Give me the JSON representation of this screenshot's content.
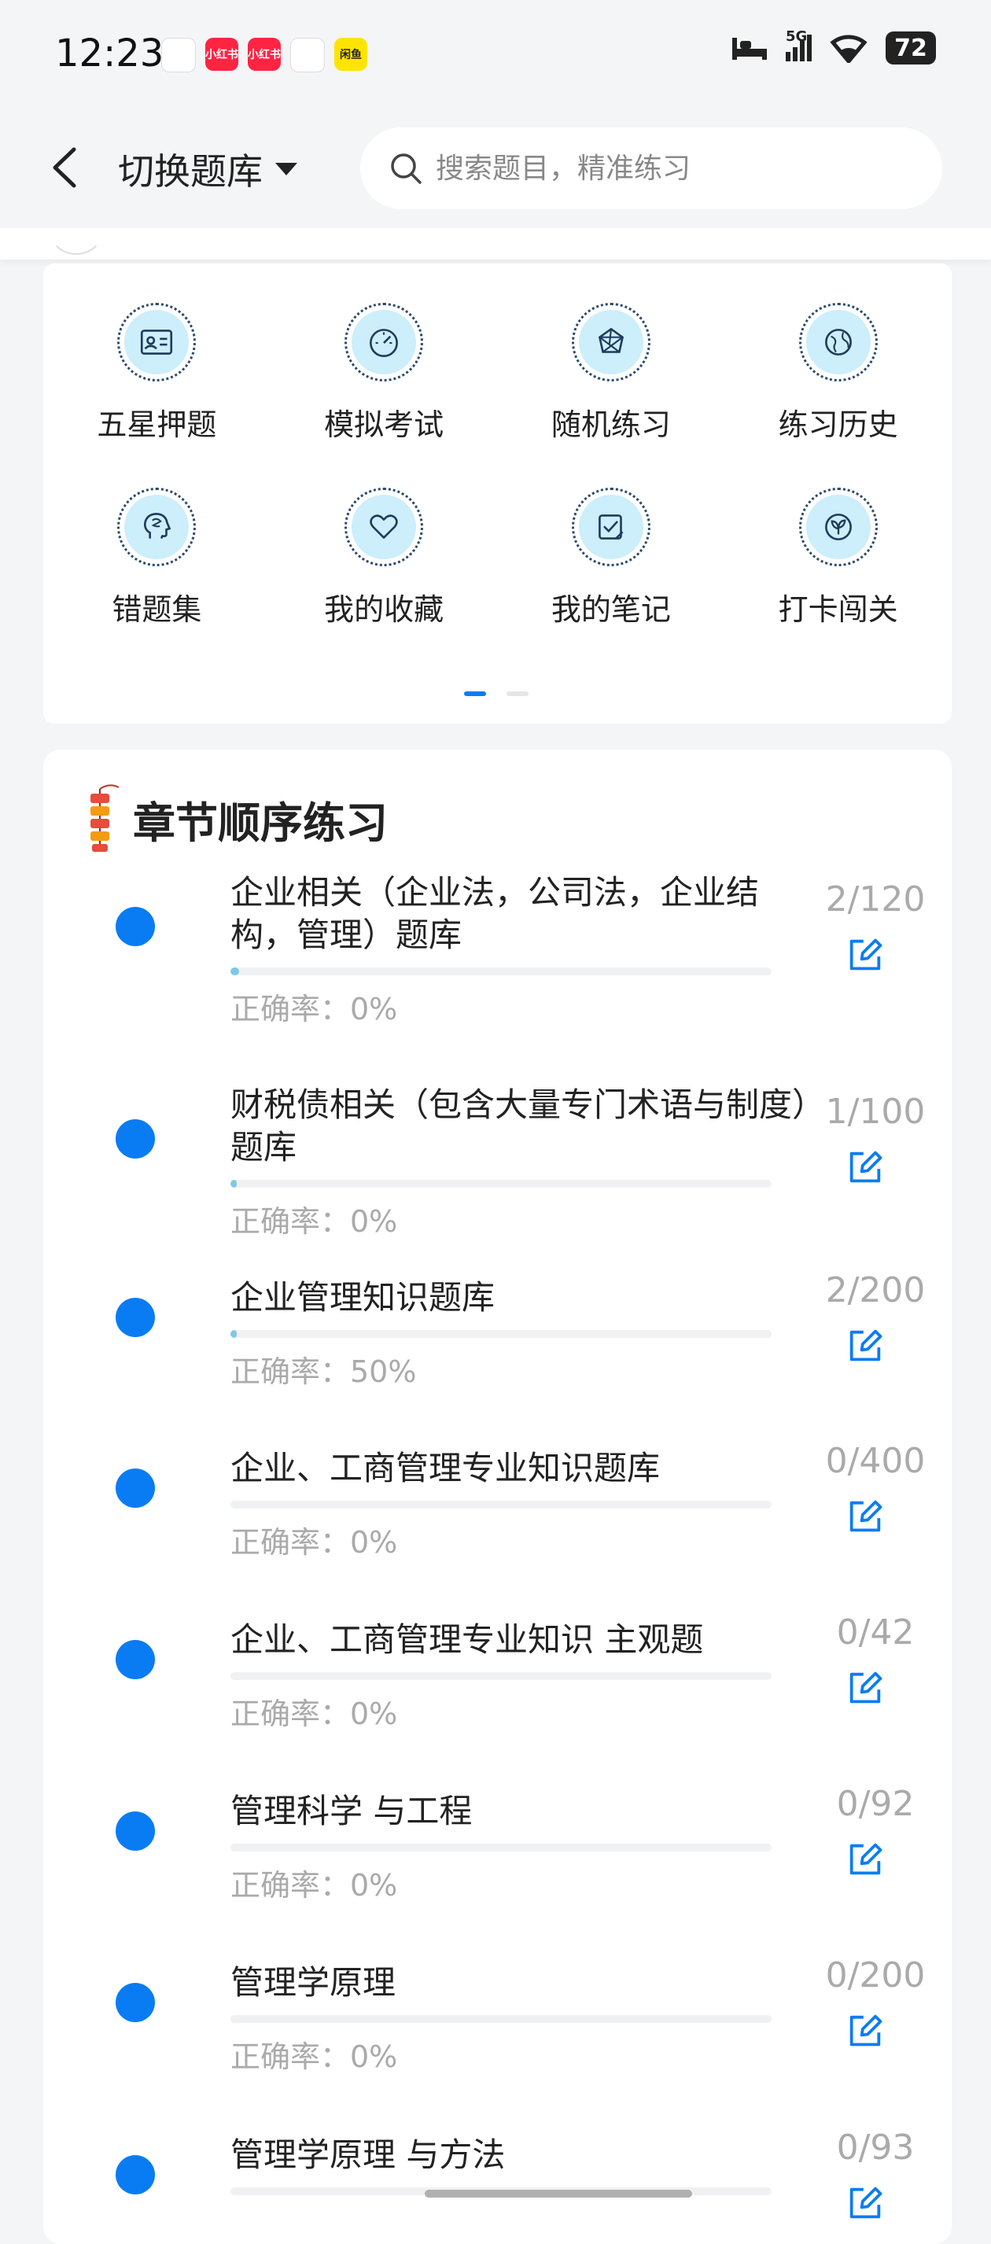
{
  "status": {
    "time": "12:23",
    "network": "5G",
    "battery": "72",
    "notification_apps": [
      {
        "name": "app-icon",
        "label": "",
        "color": "#ffffff"
      },
      {
        "name": "xiaohongshu-icon",
        "label": "小红书",
        "color": "#ff2442"
      },
      {
        "name": "xiaohongshu-icon",
        "label": "小红书",
        "color": "#ff2442"
      },
      {
        "name": "app-icon",
        "label": "",
        "color": "#ffffff"
      },
      {
        "name": "app-icon",
        "label": "闲鱼",
        "color": "#ffe400"
      }
    ]
  },
  "nav": {
    "title": "切换题库",
    "search_placeholder": "搜索题目，精准练习"
  },
  "functions": [
    {
      "label": "五星押题",
      "icon": "id-card-icon"
    },
    {
      "label": "模拟考试",
      "icon": "gauge-icon"
    },
    {
      "label": "随机练习",
      "icon": "random-icon"
    },
    {
      "label": "练习历史",
      "icon": "globe-icon"
    },
    {
      "label": "错题集",
      "icon": "head-icon"
    },
    {
      "label": "我的收藏",
      "icon": "heart-icon"
    },
    {
      "label": "我的笔记",
      "icon": "note-check-icon"
    },
    {
      "label": "打卡闯关",
      "icon": "leaf-icon"
    }
  ],
  "pager": {
    "total": 2,
    "active": 0
  },
  "chapter": {
    "title": "章节顺序练习",
    "items": [
      {
        "title": "企业相关（企业法，公司法，企业结构，管理）题库",
        "count": "2/120",
        "accuracy": "正确率：0%",
        "progress": 0.0167
      },
      {
        "title": "财税债相关（包含大量专门术语与制度）题库",
        "count": "1/100",
        "accuracy": "正确率：0%",
        "progress": 0.01
      },
      {
        "title": "企业管理知识题库",
        "count": "2/200",
        "accuracy": "正确率：50%",
        "progress": 0.01
      },
      {
        "title": "企业、工商管理专业知识题库",
        "count": "0/400",
        "accuracy": "正确率：0%",
        "progress": 0
      },
      {
        "title": "企业、工商管理专业知识 主观题",
        "count": "0/42",
        "accuracy": "正确率：0%",
        "progress": 0
      },
      {
        "title": "管理科学 与工程",
        "count": "0/92",
        "accuracy": "正确率：0%",
        "progress": 0
      },
      {
        "title": "管理学原理",
        "count": "0/200",
        "accuracy": "正确率：0%",
        "progress": 0
      },
      {
        "title": "管理学原理 与方法",
        "count": "0/93",
        "accuracy": "",
        "progress": 0
      }
    ]
  },
  "colors": {
    "accent": "#0a7cf3",
    "progress": "#7ec8e6",
    "icon_bg": "#cdeefb",
    "icon_stroke": "#1f3a5c",
    "muted": "#aaaaaa"
  }
}
